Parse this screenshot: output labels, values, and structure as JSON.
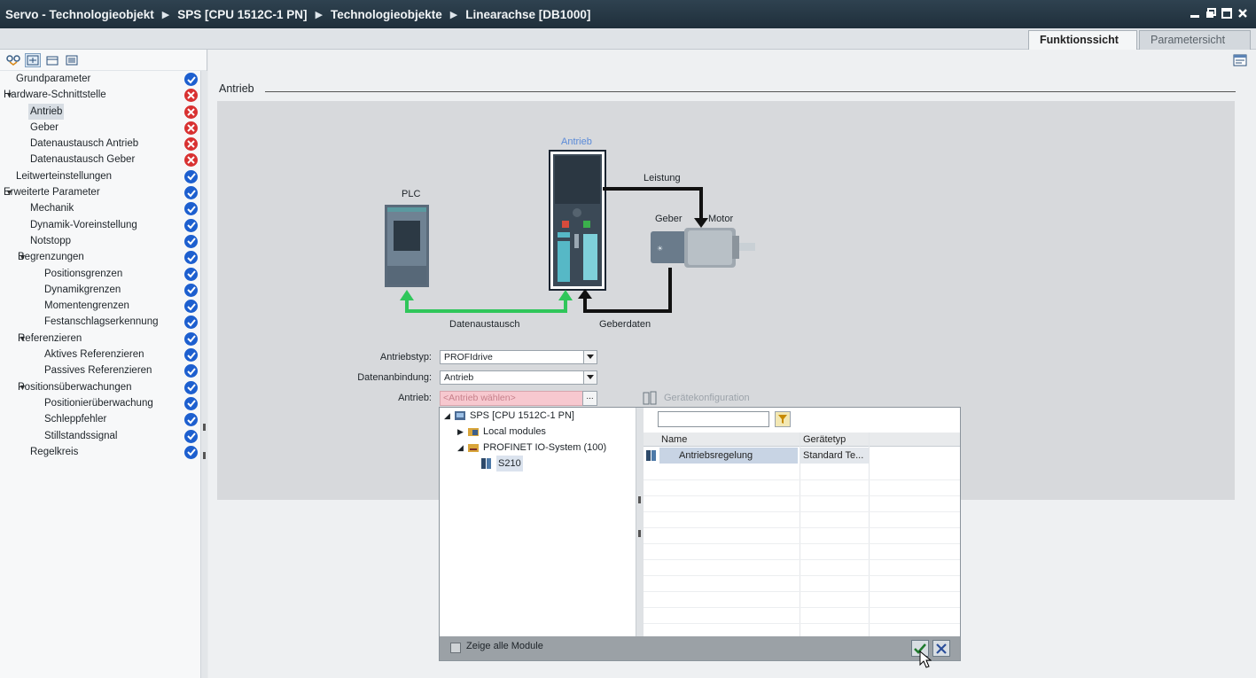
{
  "titlebar": {
    "breadcrumbs": [
      "Servo - Technologieobjekt",
      "SPS [CPU 1512C-1 PN]",
      "Technologieobjekte",
      "Linearachse [DB1000]"
    ]
  },
  "tabs": {
    "function_view": "Funktionssicht",
    "parameter_view": "Parametersicht"
  },
  "nav": {
    "items": [
      {
        "label": "Grundparameter",
        "status": "ok"
      },
      {
        "label": "Hardware-Schnittstelle",
        "status": "error",
        "expanded": true
      },
      {
        "label": "Antrieb",
        "status": "error",
        "selected": true
      },
      {
        "label": "Geber",
        "status": "error"
      },
      {
        "label": "Datenaustausch Antrieb",
        "status": "error"
      },
      {
        "label": "Datenaustausch Geber",
        "status": "error"
      },
      {
        "label": "Leitwerteinstellungen",
        "status": "ok"
      },
      {
        "label": "Erweiterte Parameter",
        "status": "ok",
        "expanded": true
      },
      {
        "label": "Mechanik",
        "status": "ok"
      },
      {
        "label": "Dynamik-Voreinstellung",
        "status": "ok"
      },
      {
        "label": "Notstopp",
        "status": "ok"
      },
      {
        "label": "Begrenzungen",
        "status": "ok",
        "expanded": true
      },
      {
        "label": "Positionsgrenzen",
        "status": "ok"
      },
      {
        "label": "Dynamikgrenzen",
        "status": "ok"
      },
      {
        "label": "Momentengrenzen",
        "status": "ok"
      },
      {
        "label": "Festanschlagserkennung",
        "status": "ok"
      },
      {
        "label": "Referenzieren",
        "status": "ok",
        "expanded": true
      },
      {
        "label": "Aktives Referenzieren",
        "status": "ok"
      },
      {
        "label": "Passives Referenzieren",
        "status": "ok"
      },
      {
        "label": "Positionsüberwachungen",
        "status": "ok",
        "expanded": true
      },
      {
        "label": "Positionierüberwachung",
        "status": "ok"
      },
      {
        "label": "Schleppfehler",
        "status": "ok"
      },
      {
        "label": "Stillstandssignal",
        "status": "ok"
      },
      {
        "label": "Regelkreis",
        "status": "ok"
      }
    ]
  },
  "section": {
    "title": "Antrieb"
  },
  "diagram": {
    "plc": "PLC",
    "drive": "Antrieb",
    "power": "Leistung",
    "encoder": "Geber",
    "motor": "Motor",
    "data_exchange": "Datenaustausch",
    "encoder_data": "Geberdaten"
  },
  "form": {
    "drive_type_label": "Antriebstyp:",
    "drive_type_value": "PROFIdrive",
    "data_connection_label": "Datenanbindung:",
    "data_connection_value": "Antrieb",
    "drive_label": "Antrieb:",
    "drive_placeholder": "<Antrieb wählen>",
    "browse_label": "...",
    "device_config_label": "Gerätekonfiguration"
  },
  "popup": {
    "tree": [
      {
        "label": "SPS [CPU 1512C-1 PN]"
      },
      {
        "label": "Local modules"
      },
      {
        "label": "PROFINET IO-System (100)"
      },
      {
        "label": "S210"
      }
    ],
    "columns": {
      "name": "Name",
      "type": "Gerätetyp"
    },
    "rows": [
      {
        "name": "Antriebsregelung",
        "type": "Standard Te..."
      }
    ],
    "show_all_modules": "Zeige alle Module"
  },
  "colors": {
    "titlebar": "#24333f",
    "ok_status": "#1d5fcf",
    "error_status": "#d83131",
    "data_arrow": "#2fc65a",
    "power_arrow": "#111111"
  }
}
